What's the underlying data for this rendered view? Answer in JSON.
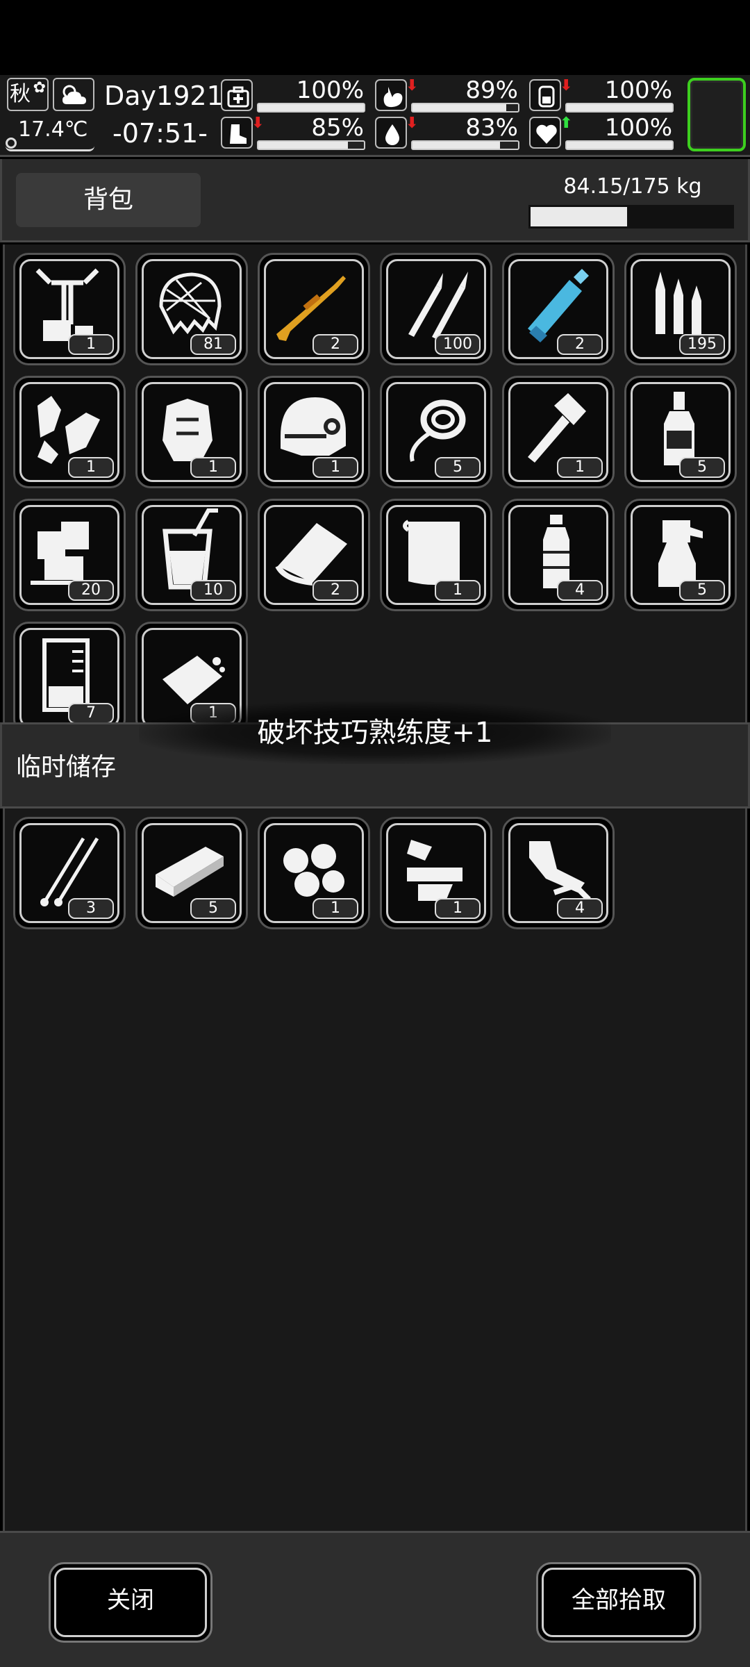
{
  "hud": {
    "season": "秋",
    "temperature": "17.4℃",
    "day": "Day1921",
    "clock": "-07:51-",
    "stats": [
      {
        "name": "health",
        "icon": "medkit-icon",
        "arrow": "",
        "pct_text": "100%",
        "level": 1.0
      },
      {
        "name": "hunger",
        "icon": "stomach-icon",
        "arrow": "down",
        "pct_text": "89%",
        "level": 0.89
      },
      {
        "name": "energy",
        "icon": "battery-icon",
        "arrow": "down",
        "pct_text": "100%",
        "level": 1.0
      },
      {
        "name": "stamina",
        "icon": "boot-icon",
        "arrow": "down",
        "pct_text": "85%",
        "level": 0.85
      },
      {
        "name": "thirst",
        "icon": "water-drop-icon",
        "arrow": "down",
        "pct_text": "83%",
        "level": 0.83
      },
      {
        "name": "mood",
        "icon": "heart-icon",
        "arrow": "up",
        "pct_text": "100%",
        "level": 1.0
      }
    ]
  },
  "backpack": {
    "tab_label": "背包",
    "weight_text": "84.15/175 kg",
    "weight_level": 0.48,
    "items": [
      {
        "name": "workbench-parts",
        "count": "1"
      },
      {
        "name": "net",
        "count": "81"
      },
      {
        "name": "sniper-rifle",
        "count": "2"
      },
      {
        "name": "bullets-large",
        "count": "100"
      },
      {
        "name": "minigun",
        "count": "2"
      },
      {
        "name": "ammo-cartridges",
        "count": "195"
      },
      {
        "name": "scrap-parts",
        "count": "1"
      },
      {
        "name": "armor-vest",
        "count": "1"
      },
      {
        "name": "tactical-helmet",
        "count": "1"
      },
      {
        "name": "rope",
        "count": "5"
      },
      {
        "name": "hatchet",
        "count": "1"
      },
      {
        "name": "liquor-bottle",
        "count": "5"
      },
      {
        "name": "ice-cubes",
        "count": "20"
      },
      {
        "name": "soda-drink",
        "count": "10"
      },
      {
        "name": "cloth-rag",
        "count": "2"
      },
      {
        "name": "towel",
        "count": "1"
      },
      {
        "name": "water-bottle",
        "count": "4"
      },
      {
        "name": "spray-bottle",
        "count": "5"
      },
      {
        "name": "beaker",
        "count": "7"
      },
      {
        "name": "soap-bar",
        "count": "1"
      }
    ]
  },
  "toast": "破坏技巧熟练度+1",
  "storage": {
    "title": "临时储存",
    "items": [
      {
        "name": "lockpicks",
        "count": "3"
      },
      {
        "name": "steel-bar",
        "count": "5"
      },
      {
        "name": "cotton-balls",
        "count": "1"
      },
      {
        "name": "gun-parts",
        "count": "1"
      },
      {
        "name": "metal-brackets",
        "count": "4"
      }
    ]
  },
  "footer": {
    "close_label": "关闭",
    "pickup_all_label": "全部拾取"
  },
  "colors": {
    "accent_slot": "#3dcf1f",
    "arrow_down": "#e02020",
    "arrow_up": "#30e040",
    "rifle_gold": "#e0a020",
    "minigun_blue": "#4ab8e0"
  }
}
